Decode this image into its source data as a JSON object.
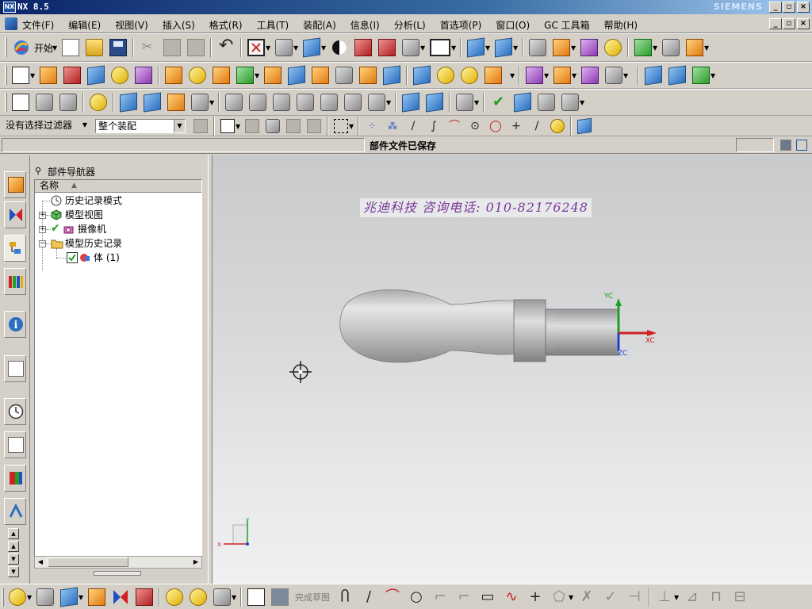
{
  "window": {
    "title": "NX 8.5",
    "brand": "SIEMENS",
    "controls": [
      "_",
      "▫",
      "×"
    ]
  },
  "menu": {
    "items": [
      "文件(F)",
      "编辑(E)",
      "视图(V)",
      "插入(S)",
      "格式(R)",
      "工具(T)",
      "装配(A)",
      "信息(I)",
      "分析(L)",
      "首选项(P)",
      "窗口(O)",
      "GC 工具箱",
      "帮助(H)"
    ]
  },
  "toolbar1": {
    "start_label": "开始"
  },
  "selection": {
    "filter_value": "没有选择过滤器",
    "scope_value": "整个装配"
  },
  "status": {
    "message": "部件文件已保存"
  },
  "navigator": {
    "title": "部件导航器",
    "column_name": "名称",
    "nodes": [
      {
        "label": "历史记录模式",
        "icon": "clock-icon"
      },
      {
        "label": "模型视图",
        "icon": "model-views-icon"
      },
      {
        "label": "摄像机",
        "icon": "camera-icon"
      },
      {
        "label": "模型历史记录",
        "icon": "folder-icon"
      },
      {
        "label": "体 (1)",
        "icon": "body-feature-icon"
      }
    ]
  },
  "graphics": {
    "watermark": "兆迪科技  咨询电话: 010-82176248",
    "wcs_labels": {
      "xc": "XC",
      "yc": "YC",
      "zc": "ZC"
    },
    "triad_labels": {
      "x": "X",
      "y": "Y"
    },
    "model_color": "#b8babc"
  },
  "bottombar": {
    "finish_sketch_label": "完成草图"
  },
  "colors": {
    "title_bar": "#0a246a",
    "face": "#d4d0c8",
    "x_axis": "#d02020",
    "y_axis": "#20a020",
    "z_axis": "#2040d0"
  }
}
